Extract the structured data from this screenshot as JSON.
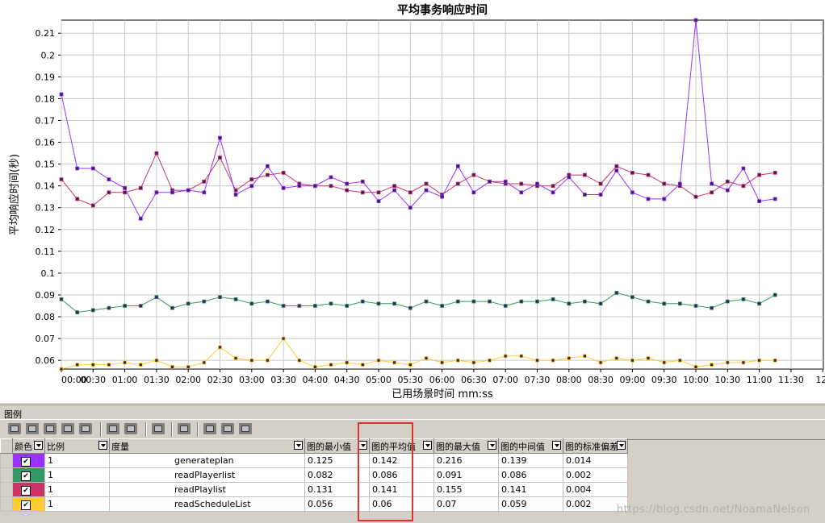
{
  "chart_data": {
    "type": "line",
    "title": "平均事务响应时间",
    "xlabel": "已用场景时间 mm:ss",
    "ylabel": "平均响应时间(秒)",
    "ylim": [
      0.056,
      0.216
    ],
    "yticks": [
      0.06,
      0.07,
      0.08,
      0.09,
      0.1,
      0.11,
      0.12,
      0.13,
      0.14,
      0.15,
      0.16,
      0.17,
      0.18,
      0.19,
      0.2,
      0.21
    ],
    "x_tick_labels": [
      "00:00",
      "00:30",
      "01:00",
      "01:30",
      "02:00",
      "02:30",
      "03:00",
      "03:30",
      "04:00",
      "04:30",
      "05:00",
      "05:30",
      "06:00",
      "06:30",
      "07:00",
      "07:30",
      "08:00",
      "08:30",
      "09:00",
      "09:30",
      "10:00",
      "10:30",
      "11:00",
      "11:30",
      "12:"
    ],
    "x_step_seconds": 15,
    "grid": true,
    "series": [
      {
        "name": "generateplan",
        "color": "#9933ff",
        "values": [
          0.182,
          0.148,
          0.148,
          0.143,
          0.139,
          0.125,
          0.137,
          0.137,
          0.138,
          0.137,
          0.162,
          0.136,
          0.14,
          0.149,
          0.139,
          0.14,
          0.14,
          0.144,
          0.141,
          0.142,
          0.133,
          0.138,
          0.13,
          0.138,
          0.135,
          0.149,
          0.137,
          0.142,
          0.142,
          0.137,
          0.141,
          0.137,
          0.144,
          0.136,
          0.136,
          0.147,
          0.137,
          0.134,
          0.134,
          0.141,
          0.216,
          0.141,
          0.138,
          0.148,
          0.133,
          0.134
        ]
      },
      {
        "name": "readPlayerlist",
        "color": "#339966",
        "values": [
          0.088,
          0.082,
          0.083,
          0.084,
          0.085,
          0.085,
          0.089,
          0.084,
          0.086,
          0.087,
          0.089,
          0.088,
          0.086,
          0.087,
          0.085,
          0.085,
          0.085,
          0.086,
          0.085,
          0.087,
          0.086,
          0.086,
          0.084,
          0.087,
          0.085,
          0.087,
          0.087,
          0.087,
          0.085,
          0.087,
          0.087,
          0.088,
          0.086,
          0.087,
          0.086,
          0.091,
          0.089,
          0.087,
          0.086,
          0.086,
          0.085,
          0.084,
          0.087,
          0.088,
          0.086,
          0.09
        ]
      },
      {
        "name": "readPlaylist",
        "color": "#cc3366",
        "values": [
          0.143,
          0.134,
          0.131,
          0.137,
          0.137,
          0.139,
          0.155,
          0.138,
          0.138,
          0.142,
          0.153,
          0.138,
          0.143,
          0.145,
          0.146,
          0.141,
          0.14,
          0.14,
          0.138,
          0.137,
          0.137,
          0.14,
          0.137,
          0.141,
          0.136,
          0.141,
          0.145,
          0.142,
          0.141,
          0.141,
          0.14,
          0.14,
          0.145,
          0.145,
          0.141,
          0.149,
          0.146,
          0.145,
          0.141,
          0.14,
          0.135,
          0.137,
          0.142,
          0.14,
          0.145,
          0.146
        ]
      },
      {
        "name": "readScheduleList",
        "color": "#ffcc33",
        "values": [
          0.056,
          0.058,
          0.058,
          0.058,
          0.059,
          0.058,
          0.06,
          0.057,
          0.057,
          0.059,
          0.066,
          0.061,
          0.06,
          0.06,
          0.07,
          0.06,
          0.057,
          0.058,
          0.059,
          0.058,
          0.06,
          0.059,
          0.058,
          0.061,
          0.059,
          0.06,
          0.059,
          0.06,
          0.062,
          0.062,
          0.06,
          0.06,
          0.061,
          0.062,
          0.059,
          0.061,
          0.06,
          0.061,
          0.059,
          0.06,
          0.057,
          0.058,
          0.059,
          0.059,
          0.06,
          0.06
        ]
      }
    ]
  },
  "legend": {
    "section_label": "图例",
    "columns": [
      "颜色",
      "比例",
      "度量",
      "图的最小值",
      "图的平均值",
      "图的最大值",
      "图的中间值",
      "图的标准偏差"
    ],
    "rows": [
      {
        "color": "#9933ff",
        "checked": "✔",
        "scale": "1",
        "measure": "generateplan",
        "min": "0.125",
        "avg": "0.142",
        "max": "0.216",
        "median": "0.139",
        "std": "0.014"
      },
      {
        "color": "#339966",
        "checked": "✔",
        "scale": "1",
        "measure": "readPlayerlist",
        "min": "0.082",
        "avg": "0.086",
        "max": "0.091",
        "median": "0.086",
        "std": "0.002"
      },
      {
        "color": "#cc3366",
        "checked": "✔",
        "scale": "1",
        "measure": "readPlaylist",
        "min": "0.131",
        "avg": "0.141",
        "max": "0.155",
        "median": "0.141",
        "std": "0.004"
      },
      {
        "color": "#ffcc33",
        "checked": "✔",
        "scale": "1",
        "measure": "readScheduleList",
        "min": "0.056",
        "avg": "0.06",
        "max": "0.07",
        "median": "0.059",
        "std": "0.002"
      }
    ]
  },
  "watermark": "https://blog.csdn.net/NoamaNelson"
}
